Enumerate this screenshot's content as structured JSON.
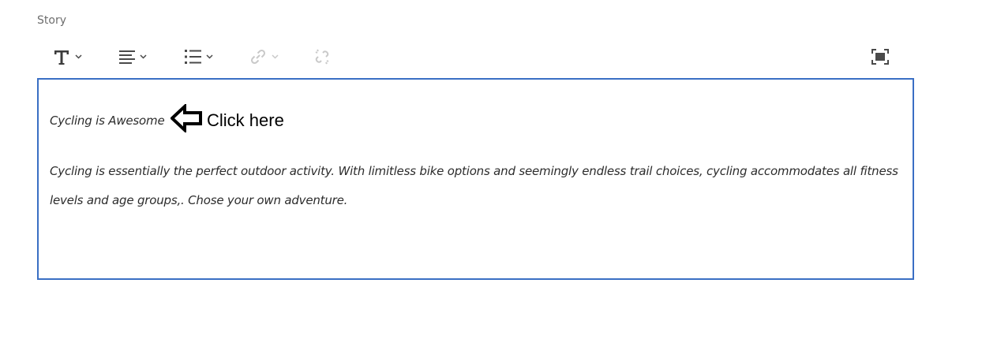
{
  "field": {
    "label": "Story"
  },
  "toolbar": {
    "buttons": [
      {
        "name": "text-style",
        "icon": "text-format-icon",
        "has_dropdown": true,
        "enabled": true
      },
      {
        "name": "alignment",
        "icon": "align-left-icon",
        "has_dropdown": true,
        "enabled": true
      },
      {
        "name": "list",
        "icon": "bulleted-list-icon",
        "has_dropdown": true,
        "enabled": true
      },
      {
        "name": "link",
        "icon": "link-icon",
        "has_dropdown": true,
        "enabled": false
      },
      {
        "name": "unlink",
        "icon": "unlink-icon",
        "has_dropdown": false,
        "enabled": false
      },
      {
        "name": "fullscreen",
        "icon": "fullscreen-icon",
        "has_dropdown": false,
        "enabled": true
      }
    ]
  },
  "editor": {
    "title": "Cycling is Awesome",
    "paragraph": "Cycling is essentially the perfect outdoor activity. With limitless bike options and seemingly endless trail choices, cycling accommodates all fitness levels and age groups,. Chose your own adventure.",
    "border_color": "#3a6fc4"
  },
  "annotation": {
    "text": "Click here",
    "icon": "arrow-left-icon"
  }
}
